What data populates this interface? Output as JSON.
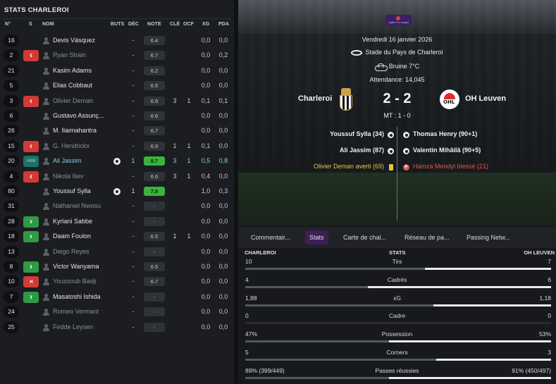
{
  "left": {
    "title": "STATS CHARLEROI",
    "headers": {
      "num": "N°",
      "s": "S",
      "name": "NOM",
      "goals": "BUTS",
      "dec": "DÉC",
      "rating": "NOTE",
      "key": "CLÉ",
      "ocf": "OCF",
      "xg": "XG",
      "pda": "PDA"
    },
    "players": [
      {
        "num": "16",
        "sub": "",
        "name": "Devis Vásquez",
        "dim": false,
        "ball": false,
        "goals": "",
        "dec": "-",
        "rating": "6.4",
        "key": "",
        "ocf": "",
        "xg": "0,0",
        "pda": "0,0"
      },
      {
        "num": "2",
        "sub": "out",
        "name": "Ryan Strain",
        "dim": true,
        "ball": false,
        "goals": "",
        "dec": "-",
        "rating": "6.7",
        "key": "",
        "ocf": "",
        "xg": "0,0",
        "pda": "0,2"
      },
      {
        "num": "21",
        "sub": "",
        "name": "Kasim Adams",
        "dim": false,
        "ball": false,
        "goals": "",
        "dec": "-",
        "rating": "6.2",
        "key": "",
        "ocf": "",
        "xg": "0,0",
        "pda": "0,0"
      },
      {
        "num": "5",
        "sub": "",
        "name": "Elias Cobbaut",
        "dim": false,
        "ball": false,
        "goals": "",
        "dec": "-",
        "rating": "6.5",
        "key": "",
        "ocf": "",
        "xg": "0,0",
        "pda": "0,0"
      },
      {
        "num": "3",
        "sub": "out",
        "name": "Olivier Deman",
        "dim": true,
        "ball": false,
        "goals": "",
        "dec": "-",
        "rating": "6.9",
        "key": "3",
        "ocf": "1",
        "xg": "0,1",
        "pda": "0,1"
      },
      {
        "num": "6",
        "sub": "",
        "name": "Gustavo Assunç...",
        "dim": false,
        "ball": false,
        "goals": "",
        "dec": "-",
        "rating": "6.6",
        "key": "",
        "ocf": "",
        "xg": "0,0",
        "pda": "0,0"
      },
      {
        "num": "26",
        "sub": "",
        "name": "M. Ilaimaharitra",
        "dim": false,
        "ball": false,
        "goals": "",
        "dec": "-",
        "rating": "6.7",
        "key": "",
        "ocf": "",
        "xg": "0,0",
        "pda": "0,0"
      },
      {
        "num": "15",
        "sub": "out",
        "name": "G. Hendrickx",
        "dim": true,
        "ball": false,
        "goals": "",
        "dec": "-",
        "rating": "6.9",
        "key": "1",
        "ocf": "1",
        "xg": "0,1",
        "pda": "0,0"
      },
      {
        "num": "20",
        "sub": "hdm",
        "name": "Ali Jassim",
        "dim": false,
        "hl": true,
        "ball": true,
        "goals": "1",
        "dec": "-",
        "rating": "8.7",
        "good": true,
        "key": "3",
        "ocf": "1",
        "xg": "0,5",
        "pda": "0,8"
      },
      {
        "num": "4",
        "sub": "out",
        "name": "Nikola Iliev",
        "dim": true,
        "ball": false,
        "goals": "",
        "dec": "-",
        "rating": "6.6",
        "key": "3",
        "ocf": "1",
        "xg": "0,4",
        "pda": "0,0"
      },
      {
        "num": "80",
        "sub": "",
        "name": "Youssuf Sylla",
        "dim": false,
        "ball": true,
        "goals": "1",
        "dec": "-",
        "rating": "7.9",
        "good": true,
        "key": "",
        "ocf": "",
        "xg": "1,0",
        "pda": "0,3"
      },
      {
        "num": "31",
        "sub": "",
        "name": "Nathaniel Nwosu",
        "dim": true,
        "ball": false,
        "goals": "",
        "dec": "-",
        "rating": "-",
        "dash": true,
        "key": "",
        "ocf": "",
        "xg": "0,0",
        "pda": "0,0"
      },
      {
        "num": "28",
        "sub": "in",
        "name": "Kyriani Sabbe",
        "dim": false,
        "ball": false,
        "goals": "",
        "dec": "-",
        "rating": "-",
        "dash": true,
        "key": "",
        "ocf": "",
        "xg": "0,0",
        "pda": "0,0"
      },
      {
        "num": "18",
        "sub": "in",
        "name": "Daam Foulon",
        "dim": false,
        "ball": false,
        "goals": "",
        "dec": "-",
        "rating": "6.5",
        "key": "1",
        "ocf": "1",
        "xg": "0,0",
        "pda": "0,0"
      },
      {
        "num": "13",
        "sub": "",
        "name": "Diego Reyes",
        "dim": true,
        "ball": false,
        "goals": "",
        "dec": "-",
        "rating": "-",
        "dash": true,
        "key": "",
        "ocf": "",
        "xg": "0,0",
        "pda": "0,0"
      },
      {
        "num": "8",
        "sub": "in",
        "name": "Victor Wanyama",
        "dim": false,
        "ball": false,
        "goals": "",
        "dec": "-",
        "rating": "6.5",
        "key": "",
        "ocf": "",
        "xg": "0,0",
        "pda": "0,0"
      },
      {
        "num": "10",
        "sub": "inout",
        "name": "Youssoub Badji",
        "dim": true,
        "ball": false,
        "goals": "",
        "dec": "-",
        "rating": "6.7",
        "key": "",
        "ocf": "",
        "xg": "0,0",
        "pda": "0,0"
      },
      {
        "num": "7",
        "sub": "in",
        "name": "Masatoshi Ishida",
        "dim": false,
        "ball": false,
        "goals": "",
        "dec": "-",
        "rating": "-",
        "dash": true,
        "key": "",
        "ocf": "",
        "xg": "0,0",
        "pda": "0,0"
      },
      {
        "num": "24",
        "sub": "",
        "name": "Romeo Vermant",
        "dim": true,
        "ball": false,
        "goals": "",
        "dec": "-",
        "rating": "-",
        "dash": true,
        "key": "",
        "ocf": "",
        "xg": "0,0",
        "pda": "0,0"
      },
      {
        "num": "25",
        "sub": "",
        "name": "Fedde Leysen",
        "dim": true,
        "ball": false,
        "goals": "",
        "dec": "-",
        "rating": "-",
        "dash": true,
        "key": "",
        "ocf": "",
        "xg": "0,0",
        "pda": "0,0"
      }
    ]
  },
  "match": {
    "league_text": "Jupiler Pro League",
    "date": "Vendredi 16 janvier 2026",
    "venue": "Stade du Pays de Charleroi",
    "weather": "Bruine 7°C",
    "attendance": "Attendance: 14,045",
    "home": "Charleroi",
    "away": "OH Leuven",
    "away_crest_text": "OHL",
    "score": "2 - 2",
    "halftime": "MT : 1 - 0",
    "events_home": [
      {
        "text": "Youssuf Sylla (34)",
        "type": "goal"
      },
      {
        "text": "Ali Jassim (87)",
        "type": "goal"
      },
      {
        "text": "Olivier Deman averti (69)",
        "type": "yellow"
      }
    ],
    "events_away": [
      {
        "text": "Thomas Henry (90+1)",
        "type": "goal"
      },
      {
        "text": "Valentin Mihăilă (90+5)",
        "type": "goal"
      },
      {
        "text": "Hamza Mendyl blessé (21)",
        "type": "injury"
      }
    ]
  },
  "tabs": [
    "Commentair...",
    "Stats",
    "Carte de chal...",
    "Réseau de pa...",
    "Passing Netw..."
  ],
  "stats": {
    "home_header": "CHARLEROI",
    "mid_header": "STATS",
    "away_header": "OH LEUVEN",
    "rows": [
      {
        "label": "Tirs",
        "home": "10",
        "away": "7",
        "home_val": 10,
        "away_val": 7
      },
      {
        "label": "Cadrés",
        "home": "4",
        "away": "6",
        "home_val": 4,
        "away_val": 6
      },
      {
        "label": "xG",
        "home": "1,88",
        "away": "1,18",
        "home_val": 1.88,
        "away_val": 1.18
      },
      {
        "label": "Cadre",
        "home": "0",
        "away": "0",
        "home_val": 0,
        "away_val": 0
      },
      {
        "label": "Possession",
        "home": "47%",
        "away": "53%",
        "home_val": 47,
        "away_val": 53
      },
      {
        "label": "Corners",
        "home": "5",
        "away": "3",
        "home_val": 5,
        "away_val": 3
      },
      {
        "label": "Passes réussies",
        "home": "89% (399/449)",
        "away": "91% (450/497)",
        "home_val": 399,
        "away_val": 450
      }
    ]
  },
  "colors": {
    "accent_tab": "#3c1f55",
    "sub_out": "#d33a36",
    "sub_in": "#2f9a46",
    "good_rating": "#39b33d",
    "highlight_name": "#7fd3e6"
  }
}
